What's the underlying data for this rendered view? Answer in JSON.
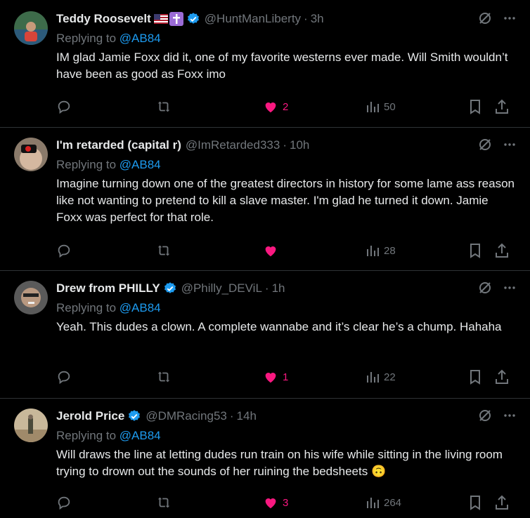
{
  "replying_label": "Replying to",
  "tweets": [
    {
      "name": "Teddy Roosevelt",
      "handle": "@HuntManLiberty",
      "time": "3h",
      "reply_to": "@AB84",
      "text": "IM glad Jamie Foxx did it,  one of my favorite westerns ever made. Will Smith wouldn’t have been as good as Foxx imo",
      "likes": "2",
      "views": "50",
      "flags": [
        "us-flag-icon",
        "latin-cross-icon"
      ],
      "verified": true
    },
    {
      "name": "I'm retarded (capital r)",
      "handle": "@ImRetarded333",
      "time": "10h",
      "reply_to": "@AB84",
      "text": "Imagine turning down one of the greatest directors in history for some lame ass reason like not wanting to pretend to kill a slave master. I'm glad he turned it down.  Jamie Foxx was perfect for that role.",
      "likes": "",
      "views": "28",
      "verified": false
    },
    {
      "name": "Drew from PHILLY",
      "handle": "@Philly_DEViL",
      "time": "1h",
      "reply_to": "@AB84",
      "text": "Yeah. This dudes a clown. A complete wannabe and it’s clear he’s a chump. Hahaha",
      "likes": "1",
      "views": "22",
      "verified": true
    },
    {
      "name": "Jerold Price",
      "handle": "@DMRacing53",
      "time": "14h",
      "reply_to": "@AB84",
      "text": "Will draws the line at letting dudes run train on his wife while sitting in the living room trying to drown out the sounds of her ruining the bedsheets 🙃",
      "likes": "3",
      "views": "264",
      "verified": true
    }
  ],
  "colors": {
    "bg": "#000000",
    "text": "#e7e9ea",
    "muted": "#71767b",
    "link": "#1d9bf0",
    "like": "#f91880",
    "divider": "#2f3336"
  }
}
